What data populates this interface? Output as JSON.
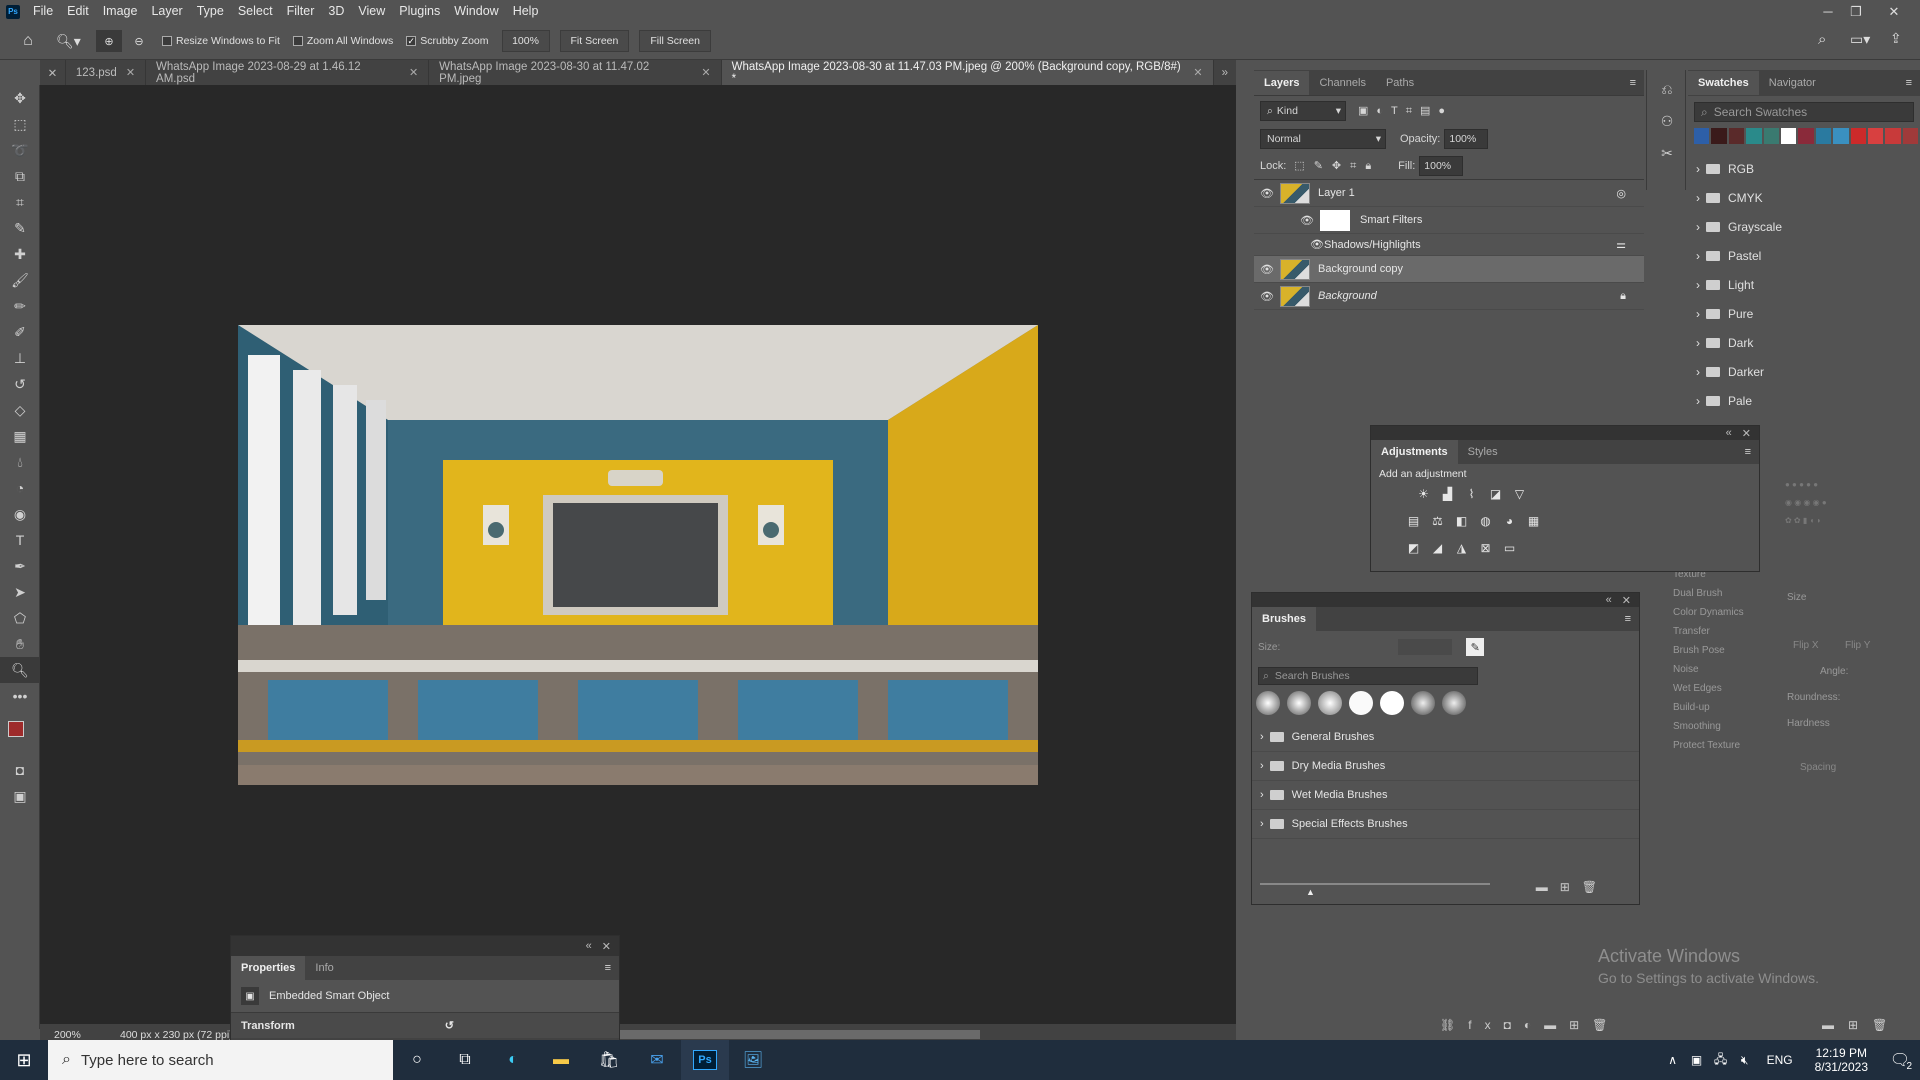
{
  "app": {
    "menu": [
      "File",
      "Edit",
      "Image",
      "Layer",
      "Type",
      "Select",
      "Filter",
      "3D",
      "View",
      "Plugins",
      "Window",
      "Help"
    ],
    "logo": "Ps"
  },
  "options": {
    "resize_windows": "Resize Windows to Fit",
    "zoom_all": "Zoom All Windows",
    "scrubby_zoom": "Scrubby Zoom",
    "zoom_value": "100%",
    "fit_screen": "Fit Screen",
    "fill_screen": "Fill Screen",
    "scrubby_checked": "✓"
  },
  "tabs": [
    {
      "label": "123.psd"
    },
    {
      "label": "WhatsApp Image 2023-08-29 at 1.46.12 AM.psd"
    },
    {
      "label": "WhatsApp Image 2023-08-30 at 11.47.02 PM.jpeg"
    },
    {
      "label": "WhatsApp Image 2023-08-30 at 11.47.03 PM.jpeg @ 200% (Background copy, RGB/8#) *"
    }
  ],
  "status": {
    "zoom": "200%",
    "size": "400 px x 230 px (72 ppi)"
  },
  "properties": {
    "tab_props": "Properties",
    "tab_info": "Info",
    "object": "Embedded Smart Object",
    "transform": "Transform"
  },
  "layers": {
    "tabs": [
      "Layers",
      "Channels",
      "Paths"
    ],
    "kind": "Kind",
    "blend": "Normal",
    "opacity_label": "Opacity:",
    "opacity": "100%",
    "lock_label": "Lock:",
    "fill_label": "Fill:",
    "fill": "100%",
    "items": [
      {
        "name": "Layer 1"
      },
      {
        "name": "Smart Filters"
      },
      {
        "name": "Shadows/Highlights"
      },
      {
        "name": "Background copy"
      },
      {
        "name": "Background"
      }
    ]
  },
  "swatches": {
    "tabs": [
      "Swatches",
      "Navigator"
    ],
    "search": "Search Swatches",
    "groups": [
      "RGB",
      "CMYK",
      "Grayscale",
      "Pastel",
      "Light",
      "Pure",
      "Dark",
      "Darker",
      "Pale"
    ],
    "colors": [
      "#2d5fa8",
      "#3a1a1a",
      "#5a2a2a",
      "#2a8a8a",
      "#3a7a70",
      "#ffffff",
      "#8a2a3a",
      "#2a7aa0",
      "#3a90c0",
      "#cc2a2a",
      "#d84040",
      "#c83a3a",
      "#a03a3a"
    ]
  },
  "adjustments": {
    "tabs": [
      "Adjustments",
      "Styles"
    ],
    "add": "Add an adjustment"
  },
  "brushes": {
    "title": "Brushes",
    "size_label": "Size:",
    "search": "Search Brushes",
    "groups": [
      "General Brushes",
      "Dry Media Brushes",
      "Wet Media Brushes",
      "Special Effects Brushes"
    ]
  },
  "brush_settings": {
    "items": [
      "Texture",
      "Dual Brush",
      "Color Dynamics",
      "Transfer",
      "Brush Pose",
      "Noise",
      "Wet Edges",
      "Build-up",
      "Smoothing",
      "Protect Texture"
    ],
    "size": "Size",
    "flipx": "Flip X",
    "flipy": "Flip Y",
    "angle": "Angle:",
    "roundness": "Roundness:",
    "hardness": "Hardness",
    "spacing": "Spacing"
  },
  "watermark": {
    "line1": "Activate Windows",
    "line2": "Go to Settings to activate Windows."
  },
  "taskbar": {
    "search": "Type here to search",
    "lang": "ENG",
    "time": "12:19 PM",
    "date": "8/31/2023",
    "notif": "2"
  }
}
